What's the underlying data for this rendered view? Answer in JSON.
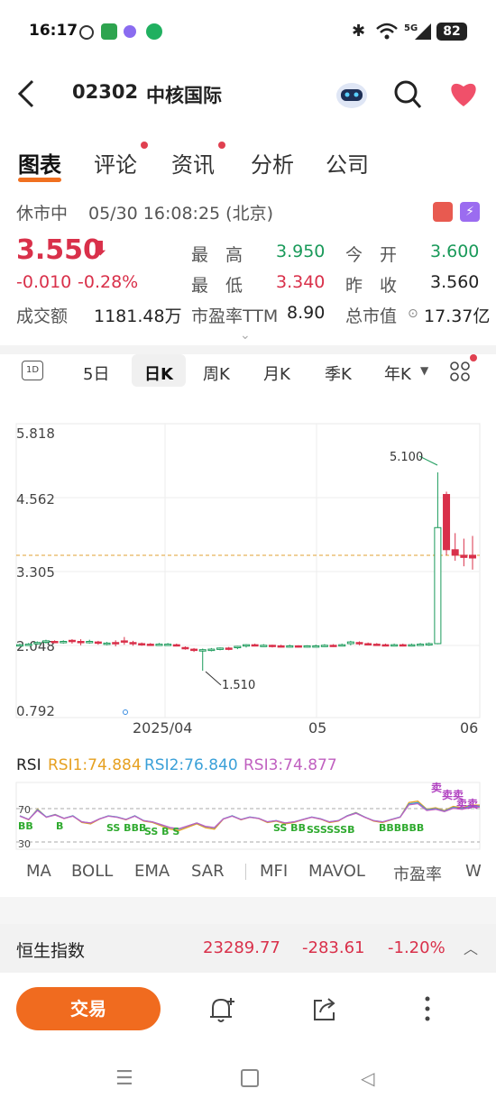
{
  "status_bar": {
    "time": "16:17",
    "battery": "82",
    "network": "5G"
  },
  "header": {
    "code": "02302",
    "name": "中核国际"
  },
  "tabs": [
    {
      "label": "图表",
      "active": true,
      "dot": false
    },
    {
      "label": "评论",
      "active": false,
      "dot": true
    },
    {
      "label": "资讯",
      "active": false,
      "dot": true
    },
    {
      "label": "分析",
      "active": false,
      "dot": false
    },
    {
      "label": "公司",
      "active": false,
      "dot": false
    }
  ],
  "market": {
    "status": "休市中",
    "datetime": "05/30 16:08:25 (北京)"
  },
  "quote": {
    "price": "3.550",
    "change": "-0.010",
    "change_pct": "-0.28%",
    "high_label": "最　高",
    "high": "3.950",
    "open_label": "今　开",
    "open": "3.600",
    "low_label": "最　低",
    "low": "3.340",
    "prev_label": "昨　收",
    "prev_close": "3.560",
    "turnover_label": "成交额",
    "turnover": "1181.48万",
    "pe_label": "市盈率TTM",
    "pe": "8.90",
    "mcap_label": "总市值",
    "mcap": "17.37亿"
  },
  "periods": [
    "5日",
    "日K",
    "周K",
    "月K",
    "季K",
    "年K"
  ],
  "active_period": "日K",
  "chart_data": {
    "type": "candlestick",
    "y_ticks": [
      "5.818",
      "4.562",
      "3.305",
      "2.048",
      "0.792"
    ],
    "ylim": [
      0.792,
      5.818
    ],
    "x_ticks": [
      "2025/04",
      "05",
      "06"
    ],
    "annotations": [
      {
        "label": "5.100",
        "value": 5.1
      },
      {
        "label": "1.510",
        "value": 1.51
      }
    ],
    "reference_line": 3.56,
    "rsi": {
      "label": "RSI",
      "rsi1": "RSI1:74.884",
      "rsi2": "RSI2:76.840",
      "rsi3": "RSI3:74.877",
      "levels": [
        "70",
        "30"
      ],
      "rsi1_color": "#e6a020",
      "rsi2_color": "#3aa0d8",
      "rsi3_color": "#c060c0"
    }
  },
  "indicators": [
    "MA",
    "BOLL",
    "EMA",
    "SAR",
    "MFI",
    "MAVOL",
    "市盈率",
    "W"
  ],
  "index_bar": {
    "name": "恒生指数",
    "value": "23289.77",
    "change": "-283.61",
    "pct": "-1.20%"
  },
  "trade_button": "交易"
}
